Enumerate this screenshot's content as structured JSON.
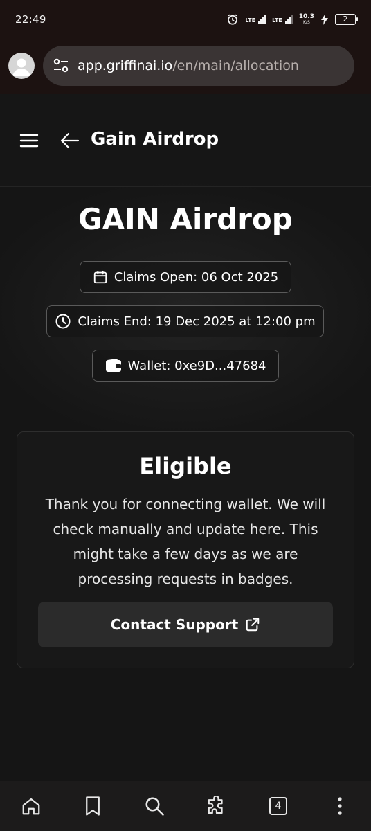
{
  "status_bar": {
    "time": "22:49",
    "network_1": "LTE",
    "network_2": "LTE",
    "speed_value": "10.3",
    "speed_unit": "K/S",
    "battery": "2",
    "icons": [
      "alarm-icon",
      "signal-icon",
      "signal-icon",
      "charging-icon",
      "battery-icon"
    ]
  },
  "browser": {
    "url_host": "app.griffinai.io",
    "url_path": "/en/main/allocation",
    "icons": [
      "avatar-icon",
      "site-settings-icon"
    ]
  },
  "header": {
    "title": "Gain Airdrop",
    "icons": [
      "menu-icon",
      "back-arrow-icon"
    ]
  },
  "hero": {
    "title": "GAIN Airdrop",
    "claims_open": "Claims Open: 06 Oct 2025",
    "claims_end": "Claims End: 19 Dec 2025 at 12:00 pm",
    "wallet": "Wallet: 0xe9D...47684",
    "icons": [
      "calendar-icon",
      "clock-icon",
      "wallet-icon"
    ]
  },
  "card": {
    "title": "Eligible",
    "message": "Thank you for connecting wallet. We will check manually and update here. This might take a few days as we are processing requests in badges.",
    "support_label": "Contact Support",
    "icons": [
      "external-link-icon"
    ]
  },
  "bottom_nav": {
    "tab_count": "4",
    "items": [
      "home-icon",
      "bookmark-icon",
      "search-icon",
      "extensions-icon",
      "tabs-icon",
      "more-icon"
    ]
  },
  "colors": {
    "background": "#151515",
    "browser_chrome": "#1c1211",
    "url_pill": "#3a3434",
    "card_background": "#181818",
    "button_background": "#2b2b2b",
    "chip_border": "#5a5a5a",
    "text": "#ffffff"
  }
}
